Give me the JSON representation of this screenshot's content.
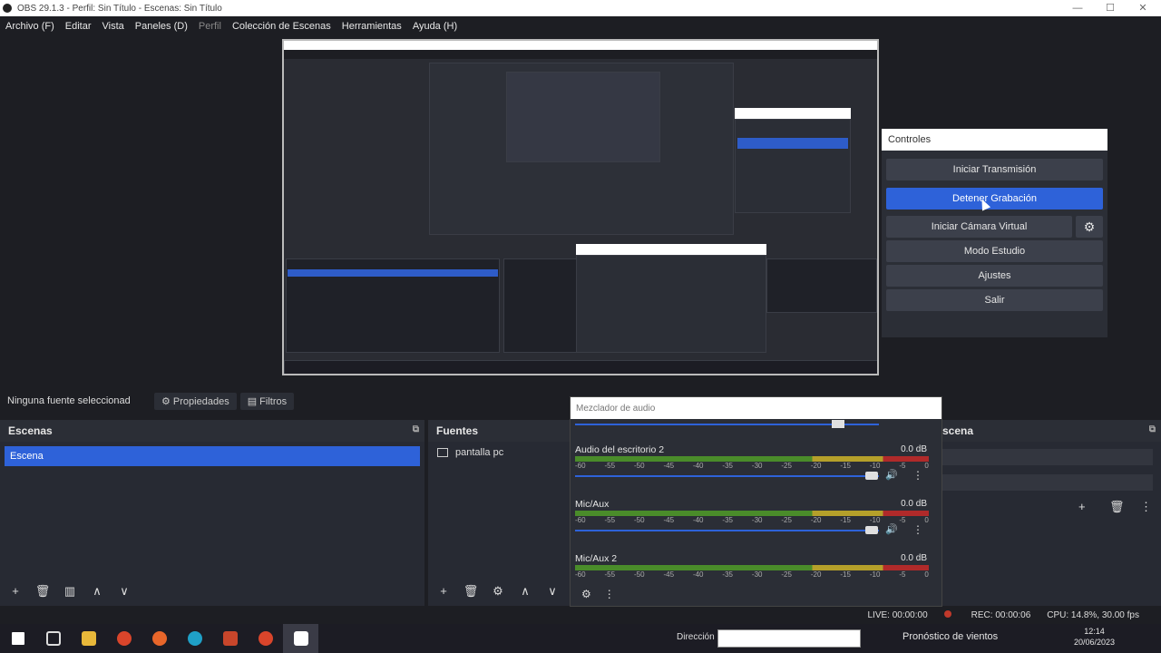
{
  "window": {
    "title": "OBS 29.1.3 - Perfil: Sin Título - Escenas: Sin Título"
  },
  "menu": [
    "Archivo (F)",
    "Editar",
    "Vista",
    "Paneles (D)",
    "Perfil",
    "Colección de Escenas",
    "Herramientas",
    "Ayuda (H)"
  ],
  "controls": {
    "title": "Controles",
    "start_stream": "Iniciar Transmisión",
    "stop_record": "Detener Grabación",
    "virtual_cam": "Iniciar Cámara Virtual",
    "studio_mode": "Modo Estudio",
    "settings": "Ajustes",
    "exit": "Salir"
  },
  "source_bar": {
    "no_source": "Ninguna fuente seleccionad",
    "properties": "Propiedades",
    "filters": "Filtros"
  },
  "scenes": {
    "title": "Escenas",
    "items": [
      "Escena"
    ]
  },
  "sources": {
    "title": "Fuentes",
    "items": [
      "pantalla pc"
    ]
  },
  "transitions": {
    "title_fragment": "scena"
  },
  "mixer": {
    "title": "Mezclador de audio",
    "channels": [
      {
        "name": "Audio del escritorio 2",
        "db": "0.0 dB"
      },
      {
        "name": "Mic/Aux",
        "db": "0.0 dB"
      },
      {
        "name": "Mic/Aux 2",
        "db": "0.0 dB"
      }
    ],
    "ticks": [
      "-60",
      "-55",
      "-50",
      "-45",
      "-40",
      "-35",
      "-30",
      "-25",
      "-20",
      "-15",
      "-10",
      "-5",
      "0"
    ]
  },
  "status": {
    "live": "LIVE: 00:00:00",
    "rec": "REC: 00:00:06",
    "cpu": "CPU: 14.8%, 30.00 fps"
  },
  "taskbar": {
    "address_label": "Dirección",
    "weather": "Pronóstico de vientos",
    "time": "12:14",
    "date": "20/06/2023"
  }
}
